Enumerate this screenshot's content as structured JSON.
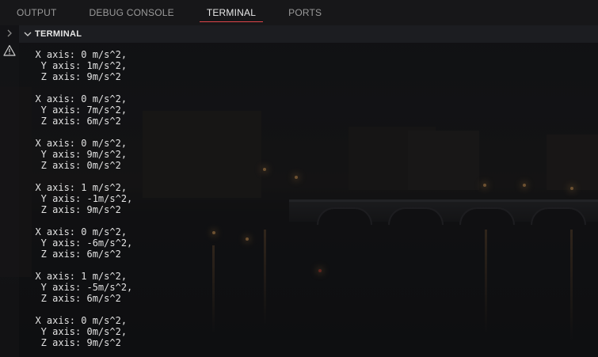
{
  "tabs": [
    {
      "label": "OUTPUT"
    },
    {
      "label": "DEBUG CONSOLE"
    },
    {
      "label": "TERMINAL",
      "active": true
    },
    {
      "label": "PORTS"
    }
  ],
  "section": {
    "title": "TERMINAL"
  },
  "icons": {
    "collapse": "chevron-right-icon",
    "warning": "warning-icon",
    "caret": "chevron-down-icon"
  },
  "colors": {
    "active_tab_underline": "#e0464a",
    "text": "#e2e2e2"
  },
  "terminal": {
    "lines": [
      [
        "  X axis: 0 m/s^2,",
        "   Y axis: 1m/s^2,",
        "   Z axis: 9m/s^2"
      ],
      [
        "  X axis: 0 m/s^2,",
        "   Y axis: 7m/s^2,",
        "   Z axis: 6m/s^2"
      ],
      [
        "  X axis: 0 m/s^2,",
        "   Y axis: 9m/s^2,",
        "   Z axis: 0m/s^2"
      ],
      [
        "  X axis: 1 m/s^2,",
        "   Y axis: -1m/s^2,",
        "   Z axis: 9m/s^2"
      ],
      [
        "  X axis: 0 m/s^2,",
        "   Y axis: -6m/s^2,",
        "   Z axis: 6m/s^2"
      ],
      [
        "  X axis: 1 m/s^2,",
        "   Y axis: -5m/s^2,",
        "   Z axis: 6m/s^2"
      ],
      [
        "  X axis: 0 m/s^2,",
        "   Y axis: 0m/s^2,",
        "   Z axis: 9m/s^2"
      ]
    ]
  }
}
